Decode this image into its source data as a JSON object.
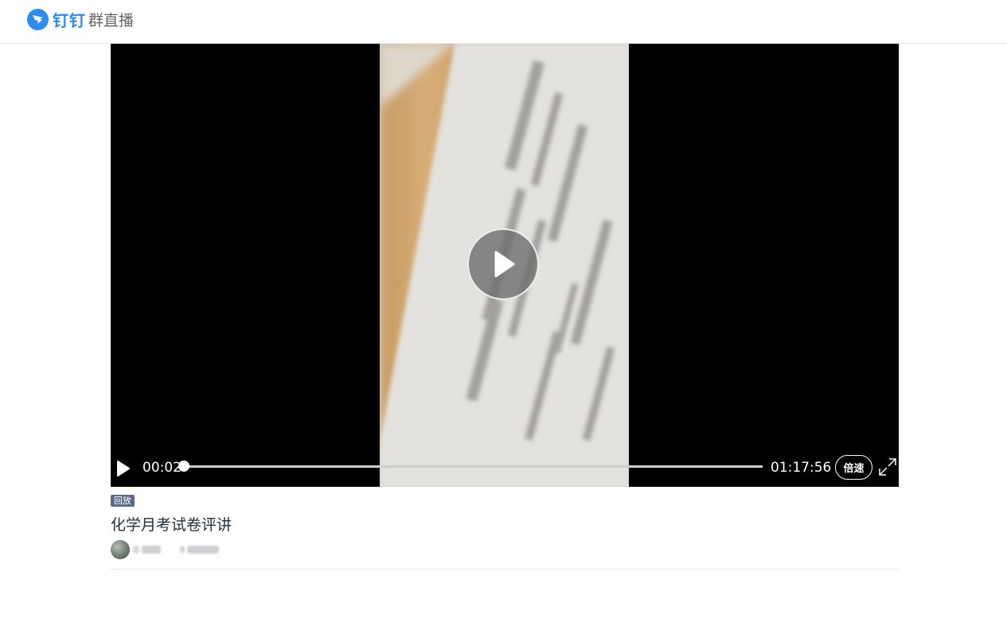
{
  "header": {
    "brand": "钉钉",
    "product": "群直播"
  },
  "player": {
    "current_time": "00:02",
    "total_time": "01:17:56",
    "progress": 0.0004,
    "speed_label": "倍速"
  },
  "live": {
    "badge": "回放",
    "title": "化学月考试卷评讲"
  },
  "icons": {
    "logo": "dingtalk-logo-icon",
    "big_play": "play-icon",
    "control_play": "play-icon",
    "fullscreen": "fullscreen-icon"
  },
  "colors": {
    "brand": "#2d8cf0",
    "badge": "#5a6a8a"
  }
}
